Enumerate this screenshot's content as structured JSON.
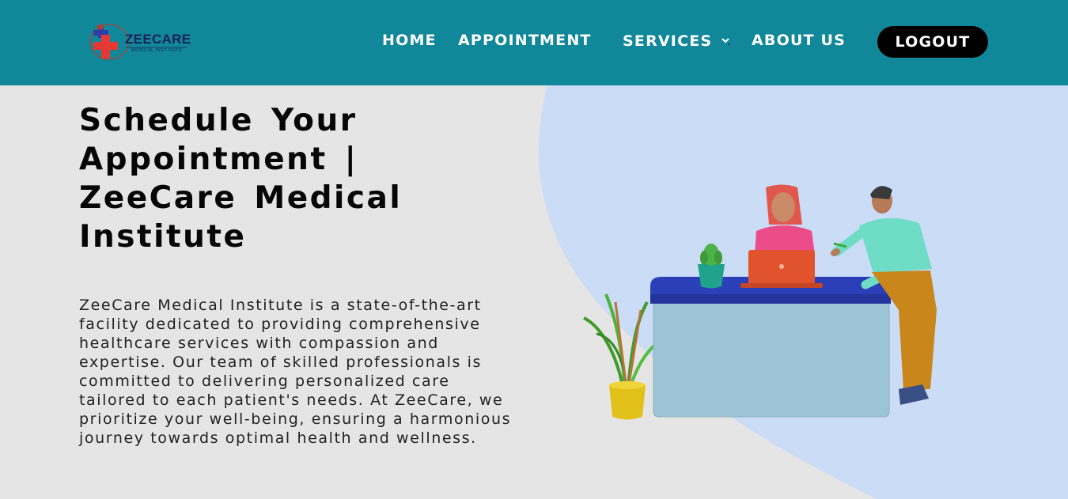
{
  "brand": {
    "name": "ZEECARE",
    "tagline": "MEDICAL INSTITUTE",
    "logo_icon": "medical-cross-icon"
  },
  "nav": {
    "items": [
      {
        "label": "HOME"
      },
      {
        "label": "APPOINTMENT"
      },
      {
        "label": "SERVICES",
        "icon": "chevron-down-icon"
      },
      {
        "label": "ABOUT US"
      }
    ],
    "logout_label": "LOGOUT"
  },
  "hero": {
    "title": "Schedule Your Appointment | ZeeCare Medical Institute",
    "description": "ZeeCare Medical Institute is a state-of-the-art facility dedicated to providing comprehensive healthcare services with compassion and expertise. Our team of skilled professionals is committed to delivering personalized care tailored to each patient's needs. At ZeeCare, we prioritize your well-being, ensuring a harmonious journey towards optimal health and wellness."
  },
  "colors": {
    "navbar_bg": "#10889a",
    "page_bg": "#e5e5e5",
    "blob": "#cbdcf7",
    "logout_bg": "#000000",
    "title_text": "#060606"
  }
}
